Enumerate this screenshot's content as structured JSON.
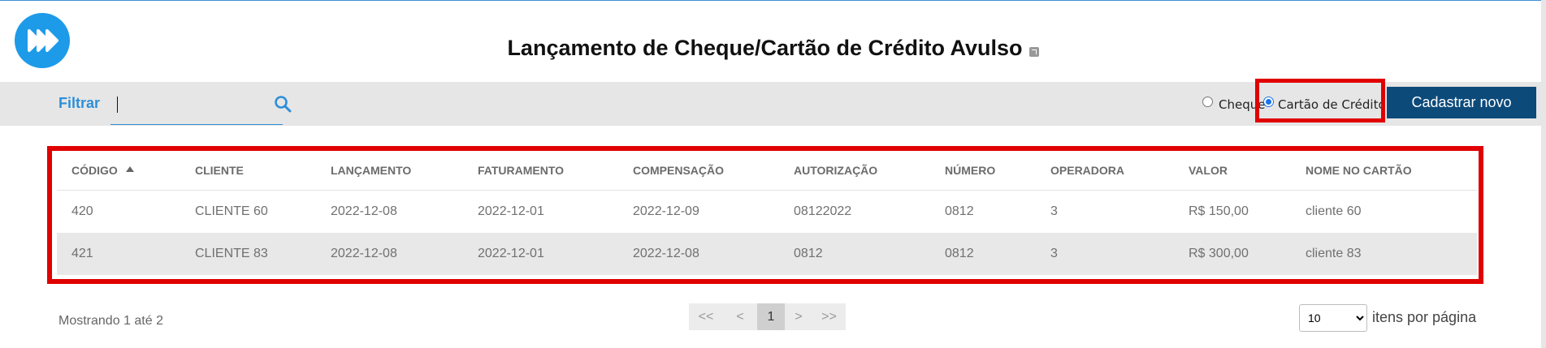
{
  "header": {
    "title": "Lançamento de Cheque/Cartão de Crédito Avulso",
    "external_icon": "external-link-icon",
    "logo_icon": "fast-forward-logo-icon"
  },
  "toolbar": {
    "filter_label": "Filtrar",
    "filter_value": "",
    "search_icon": "search-icon",
    "radio_cheque": "Cheque",
    "radio_card": "Cartão de Crédito",
    "selected": "Cartão de Crédito",
    "new_button": "Cadastrar novo"
  },
  "table": {
    "columns": [
      "CÓDIGO",
      "CLIENTE",
      "LANÇAMENTO",
      "FATURAMENTO",
      "COMPENSAÇÃO",
      "AUTORIZAÇÃO",
      "NÚMERO",
      "OPERADORA",
      "VALOR",
      "NOME NO CARTÃO"
    ],
    "sorted_column": "CÓDIGO",
    "rows": [
      [
        "420",
        "CLIENTE 60",
        "2022-12-08",
        "2022-12-01",
        "2022-12-09",
        "08122022",
        "0812",
        "3",
        "R$ 150,00",
        "cliente 60"
      ],
      [
        "421",
        "CLIENTE 83",
        "2022-12-08",
        "2022-12-01",
        "2022-12-08",
        "0812",
        "0812",
        "3",
        "R$ 300,00",
        "cliente 83"
      ]
    ]
  },
  "footer": {
    "showing": "Mostrando 1 até 2",
    "pager": {
      "first": "<<",
      "prev": "<",
      "current": "1",
      "next": ">",
      "last": ">>"
    },
    "per_page_value": "10",
    "per_page_label": "itens por página"
  },
  "colors": {
    "brand_blue": "#1e9be8",
    "button_dark": "#0c4a7a",
    "highlight_red": "#e00000",
    "link_blue": "#2d8fd8"
  }
}
